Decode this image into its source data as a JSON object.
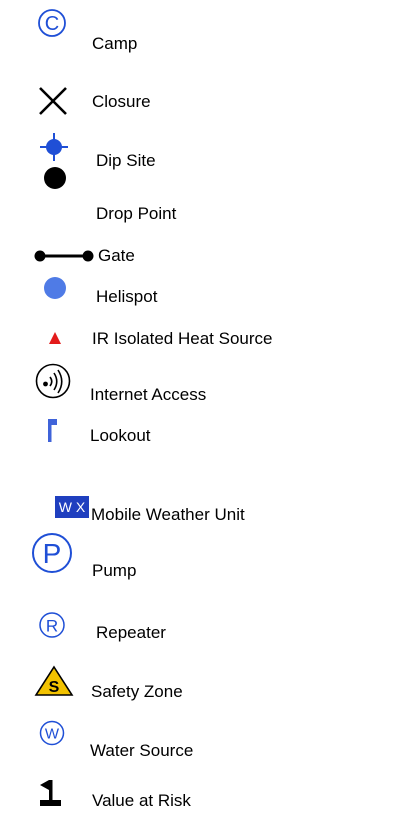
{
  "colors": {
    "blue_symbol": "#1f4fd6",
    "helispot": "#4f7be6",
    "lookout": "#3f63d9",
    "wx_background": "#1f3fbf",
    "heat_source": "#e31b1b",
    "safety_zone_yellow": "#f2c200",
    "black": "#000000"
  },
  "legend": [
    {
      "label": "Camp",
      "icon": "circled-c-icon"
    },
    {
      "label": "Closure",
      "icon": "x-closure-icon"
    },
    {
      "label": "Dip Site",
      "icon": "crosshair-dip-site-icon"
    },
    {
      "label": "Drop Point",
      "icon": "filled-circle-drop-point-icon"
    },
    {
      "label": "Gate",
      "icon": "gate-icon"
    },
    {
      "label": "Helispot",
      "icon": "helispot-dot-icon"
    },
    {
      "label": "IR Isolated Heat Source",
      "icon": "red-triangle-icon"
    },
    {
      "label": "Internet Access",
      "icon": "wifi-circle-icon"
    },
    {
      "label": "Lookout",
      "icon": "lookout-flag-icon"
    },
    {
      "label": "Mobile Weather Unit",
      "icon": "wx-badge-icon",
      "icon_text": "W X"
    },
    {
      "label": "Pump",
      "icon": "circled-p-icon"
    },
    {
      "label": "Repeater",
      "icon": "circled-r-icon"
    },
    {
      "label": "Safety Zone",
      "icon": "safety-zone-triangle-icon",
      "icon_text": "S"
    },
    {
      "label": "Water Source",
      "icon": "circled-w-icon"
    },
    {
      "label": "Value at Risk",
      "icon": "value-at-risk-flag-icon"
    }
  ]
}
